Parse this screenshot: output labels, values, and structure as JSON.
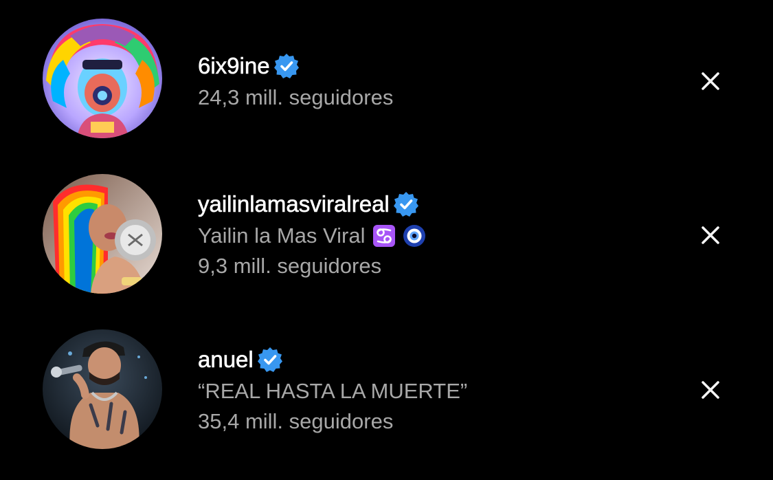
{
  "suggestions": [
    {
      "username": "6ix9ine",
      "verified": true,
      "display_name": "",
      "followers": "24,3 mill. seguidores",
      "avatar_icon": "rainbow-hair-avatar"
    },
    {
      "username": "yailinlamasviralreal",
      "verified": true,
      "display_name": "Yailin la Mas Viral",
      "display_name_emojis": [
        "cancer-zodiac-icon",
        "nazar-eye-icon"
      ],
      "followers": "9,3 mill. seguidores",
      "avatar_icon": "rainbow-hair-woman-avatar"
    },
    {
      "username": "anuel",
      "verified": true,
      "display_name": "“REAL HASTA LA MUERTE”",
      "followers": "35,4 mill. seguidores",
      "avatar_icon": "singer-with-microphone-avatar"
    }
  ],
  "colors": {
    "background": "#000000",
    "username": "#ffffff",
    "secondary_text": "#a8a8a8",
    "verified_badge": "#3897f0",
    "close_icon": "#f5f5f5"
  }
}
